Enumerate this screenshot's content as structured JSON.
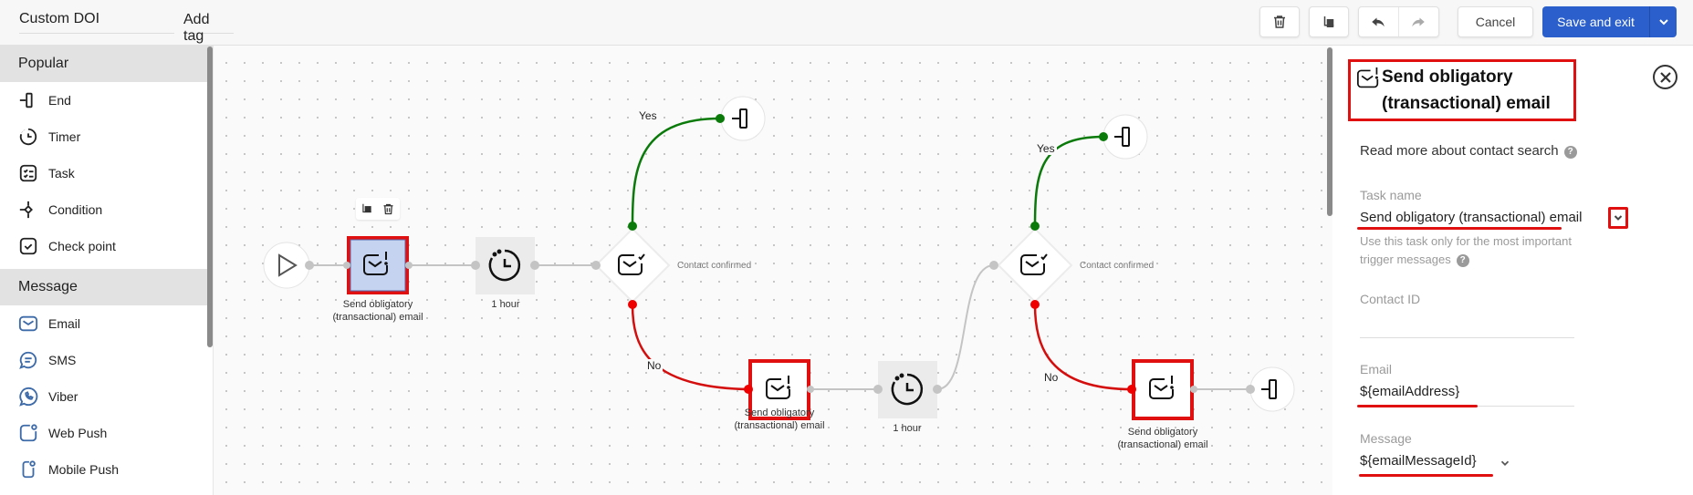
{
  "header": {
    "title_value": "Custom DOI",
    "tag_placeholder": "Add tag",
    "delete_tooltip": "trash-icon",
    "copy_tooltip": "copy-icon",
    "cancel_label": "Cancel",
    "save_label": "Save and exit"
  },
  "sidebar": {
    "sections": [
      {
        "title": "Popular",
        "items": [
          {
            "label": "End",
            "icon": "end-icon"
          },
          {
            "label": "Timer",
            "icon": "timer-icon"
          },
          {
            "label": "Task",
            "icon": "task-icon"
          },
          {
            "label": "Condition",
            "icon": "condition-icon"
          },
          {
            "label": "Check point",
            "icon": "checkpoint-icon"
          }
        ]
      },
      {
        "title": "Message",
        "items": [
          {
            "label": "Email",
            "icon": "email-icon"
          },
          {
            "label": "SMS",
            "icon": "sms-icon"
          },
          {
            "label": "Viber",
            "icon": "viber-icon"
          },
          {
            "label": "Web Push",
            "icon": "web-push-icon"
          },
          {
            "label": "Mobile Push",
            "icon": "mobile-push-icon"
          }
        ]
      }
    ]
  },
  "canvas": {
    "nodes": {
      "task1_label_line1": "Send obligatory",
      "task1_label_line2": "(transactional) email",
      "timer1_label": "1 hour",
      "cond1_label": "Contact confirmed",
      "task2_label_line1": "Send obligatory",
      "task2_label_line2": "(transactional) email",
      "timer2_label": "1 hour",
      "cond2_label": "Contact confirmed",
      "task3_label_line1": "Send obligatory",
      "task3_label_line2": "(transactional) email"
    },
    "edges": {
      "yes1": "Yes",
      "no1": "No",
      "yes2": "Yes",
      "no2": "No"
    },
    "colors": {
      "yes": "#0a7a0a",
      "no": "#d40d0d",
      "neutral": "#c4c4c4",
      "highlight": "#e01010",
      "selected_fill": "#c5d3f0"
    }
  },
  "panel": {
    "title_line1": "Send obligatory",
    "title_line2": "(transactional) email",
    "help_link": "Read more about contact search",
    "task_name_label": "Task name",
    "task_name_value": "Send obligatory (transactional) email",
    "task_hint": "Use this task only for the most important trigger messages",
    "contact_id_label": "Contact ID",
    "contact_id_value": "",
    "email_label": "Email",
    "email_value": "${emailAddress}",
    "message_label": "Message",
    "message_value": "${emailMessageId}"
  },
  "colors": {
    "primary": "#2a5fcc",
    "highlight_red": "#e01010"
  }
}
